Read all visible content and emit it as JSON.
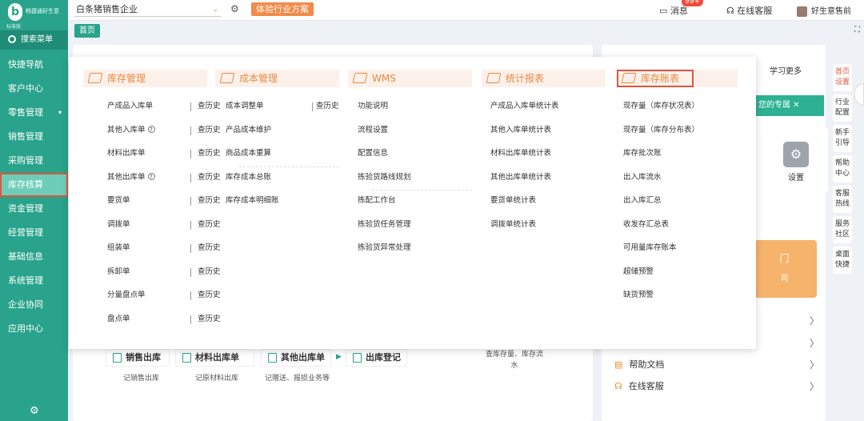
{
  "logo": {
    "brand": "畅捷通好生意",
    "edition": "标准版",
    "mark": "b"
  },
  "sidebar": {
    "search_label": "搜索菜单",
    "items": [
      {
        "label": "快捷导航"
      },
      {
        "label": "客户中心"
      },
      {
        "label": "零售管理",
        "caret": "▾"
      },
      {
        "label": "销售管理"
      },
      {
        "label": "采购管理"
      },
      {
        "label": "库存核算"
      },
      {
        "label": "资金管理"
      },
      {
        "label": "经营管理"
      },
      {
        "label": "基础信息"
      },
      {
        "label": "系统管理"
      },
      {
        "label": "企业协同"
      },
      {
        "label": "应用中心"
      }
    ],
    "active_index": 5
  },
  "topbar": {
    "company": "白条猪销售企业",
    "trial": "体验行业方案",
    "messages": "消息",
    "badge": "99+",
    "service": "在线客服",
    "user": "好生意售前"
  },
  "tabs": {
    "home": "首页"
  },
  "right_rail": [
    {
      "label": "首页设置"
    },
    {
      "label": "行业配置"
    },
    {
      "label": "新手引导"
    },
    {
      "label": "帮助中心"
    },
    {
      "label": "客服热线"
    },
    {
      "label": "服务社区"
    },
    {
      "label": "桌面快捷"
    }
  ],
  "background": {
    "learn_more": "学习更多",
    "exclusive": "您的专属",
    "settings": "设置",
    "orange_line1": "门",
    "orange_line2": "司",
    "flows": [
      {
        "label": "销售出库",
        "sub": "记销售出库"
      },
      {
        "label": "材料出库单",
        "sub": "记原材料出库"
      },
      {
        "label": "其他出库单",
        "sub": "记赠送、报损业务等"
      },
      {
        "label": "出库登记",
        "sub": ""
      }
    ],
    "flow_note": "查库存量、库存流水",
    "help_docs": "帮助文档",
    "online_service": "在线客服"
  },
  "mega_menu": {
    "history": "查历史",
    "columns": [
      {
        "title": "库存管理",
        "items": [
          {
            "label": "产成品入库单",
            "history": true
          },
          {
            "label": "其他入库单",
            "help": true,
            "history": true
          },
          {
            "label": "材料出库单",
            "history": true
          },
          {
            "label": "其他出库单",
            "help": true,
            "history": true
          },
          {
            "label": "要货单",
            "history": true
          },
          {
            "label": "调拨单",
            "history": true
          },
          {
            "label": "组装单",
            "history": true
          },
          {
            "label": "拆卸单",
            "history": true
          },
          {
            "label": "分量盘点单",
            "history": true
          },
          {
            "label": "盘点单",
            "history": true
          }
        ]
      },
      {
        "title": "成本管理",
        "items": [
          {
            "label": "成本调整单",
            "history": true
          },
          {
            "label": "产品成本维护"
          },
          {
            "label": "商品成本重算",
            "divider": true
          },
          {
            "label": "库存成本总账"
          },
          {
            "label": "库存成本明细账"
          }
        ]
      },
      {
        "title": "WMS",
        "items": [
          {
            "label": "功能说明"
          },
          {
            "label": "流程设置"
          },
          {
            "label": "配置信息"
          },
          {
            "label": "拣验货路线规划",
            "divider": true
          },
          {
            "label": "拣配工作台"
          },
          {
            "label": "拣验货任务管理"
          },
          {
            "label": "拣验货异常处理"
          }
        ]
      },
      {
        "title": "统计报表",
        "items": [
          {
            "label": "产成品入库单统计表"
          },
          {
            "label": "其他入库单统计表"
          },
          {
            "label": "材料出库单统计表"
          },
          {
            "label": "其他出库单统计表"
          },
          {
            "label": "要货单统计表"
          },
          {
            "label": "调拨单统计表"
          }
        ]
      },
      {
        "title": "库存账表",
        "items": [
          {
            "label": "现存量（库存状况表）"
          },
          {
            "label": "现存量（库存分布表）"
          },
          {
            "label": "库存批次账"
          },
          {
            "label": "出入库流水"
          },
          {
            "label": "出入库汇总"
          },
          {
            "label": "收发存汇总表"
          },
          {
            "label": "可用量库存账本"
          },
          {
            "label": "超储预警"
          },
          {
            "label": "缺货预警"
          }
        ]
      }
    ]
  },
  "colors": {
    "primary": "#29a38b",
    "accent": "#e8893f",
    "highlight": "#e0553d"
  }
}
